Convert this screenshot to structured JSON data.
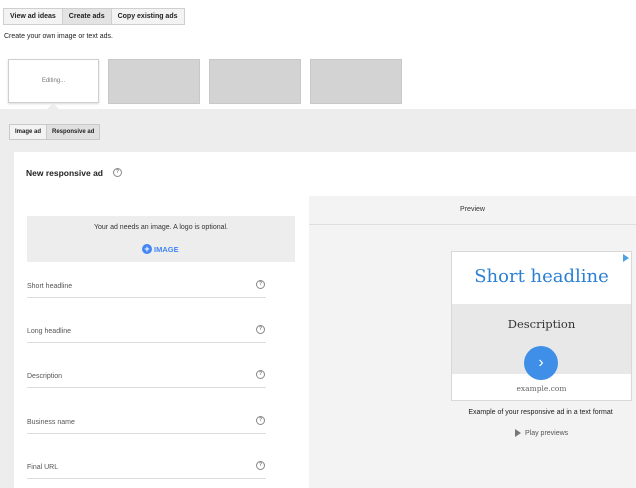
{
  "top_tabs": [
    {
      "label": "View ad ideas",
      "active": false
    },
    {
      "label": "Create ads",
      "active": true
    },
    {
      "label": "Copy existing ads",
      "active": false
    }
  ],
  "subtitle": "Create your own image or text ads.",
  "thumbnails": {
    "editing_label": "Editing..."
  },
  "ad_type_tabs": [
    {
      "label": "Image ad",
      "active": false
    },
    {
      "label": "Responsive ad",
      "active": true
    }
  ],
  "card_title": "New responsive ad",
  "image_area": {
    "message": "Your ad needs an image. A logo is optional.",
    "button_label": "IMAGE"
  },
  "fields": [
    {
      "label": "Short headline"
    },
    {
      "label": "Long headline"
    },
    {
      "label": "Description"
    },
    {
      "label": "Business name"
    },
    {
      "label": "Final URL"
    }
  ],
  "preview": {
    "title": "Preview",
    "headline": "Short headline",
    "description": "Description",
    "url": "example.com",
    "caption": "Example of your responsive ad in a text format",
    "play_label": "Play previews"
  },
  "colors": {
    "accent": "#4285f4",
    "headline": "#2a7fd4",
    "workspace": "#ededed"
  }
}
